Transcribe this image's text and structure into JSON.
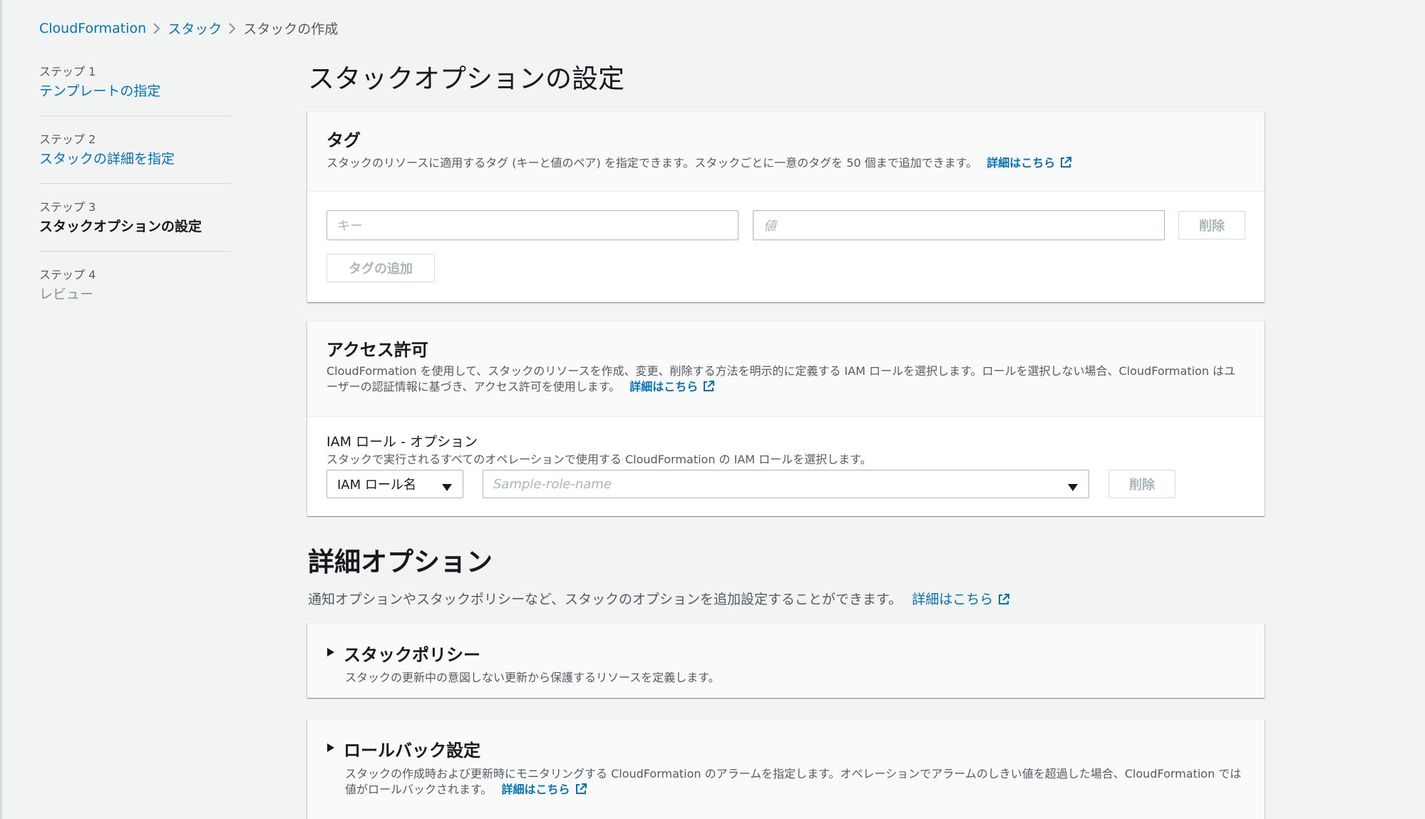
{
  "breadcrumb": {
    "items": [
      {
        "label": "CloudFormation"
      },
      {
        "label": "スタック"
      },
      {
        "label": "スタックの作成"
      }
    ]
  },
  "steps": [
    {
      "num": "ステップ 1",
      "title": "テンプレートの指定",
      "state": "link"
    },
    {
      "num": "ステップ 2",
      "title": "スタックの詳細を指定",
      "state": "link"
    },
    {
      "num": "ステップ 3",
      "title": "スタックオプションの設定",
      "state": "current"
    },
    {
      "num": "ステップ 4",
      "title": "レビュー",
      "state": "disabled"
    }
  ],
  "page_title": "スタックオプションの設定",
  "tags": {
    "title": "タグ",
    "desc": "スタックのリソースに適用するタグ (キーと値のペア) を指定できます。スタックごとに一意のタグを 50 個まで追加できます。",
    "learn_more": "詳細はこちら",
    "key_placeholder": "キー",
    "value_placeholder": "値",
    "remove_label": "削除",
    "add_label": "タグの追加"
  },
  "access": {
    "title": "アクセス許可",
    "desc": "CloudFormation を使用して、スタックのリソースを作成、変更、削除する方法を明示的に定義する IAM ロールを選択します。ロールを選択しない場合、CloudFormation はユーザーの認証情報に基づき、アクセス許可を使用します。",
    "learn_more": "詳細はこちら",
    "iam_label": "IAM ロール - オプション",
    "iam_desc": "スタックで実行されるすべてのオペレーションで使用する CloudFormation の IAM ロールを選択します。",
    "role_type_value": "IAM ロール名",
    "role_name_placeholder": "Sample-role-name",
    "remove_label": "削除"
  },
  "advanced": {
    "title": "詳細オプション",
    "desc": "通知オプションやスタックポリシーなど、スタックのオプションを追加設定することができます。",
    "learn_more": "詳細はこちら"
  },
  "stack_policy": {
    "title": "スタックポリシー",
    "desc": "スタックの更新中の意図しない更新から保護するリソースを定義します。"
  },
  "rollback": {
    "title": "ロールバック設定",
    "desc": "スタックの作成時および更新時にモニタリングする CloudFormation のアラームを指定します。オペレーションでアラームのしきい値を超過した場合、CloudFormation では値がロールバックされます。",
    "learn_more": "詳細はこちら"
  }
}
